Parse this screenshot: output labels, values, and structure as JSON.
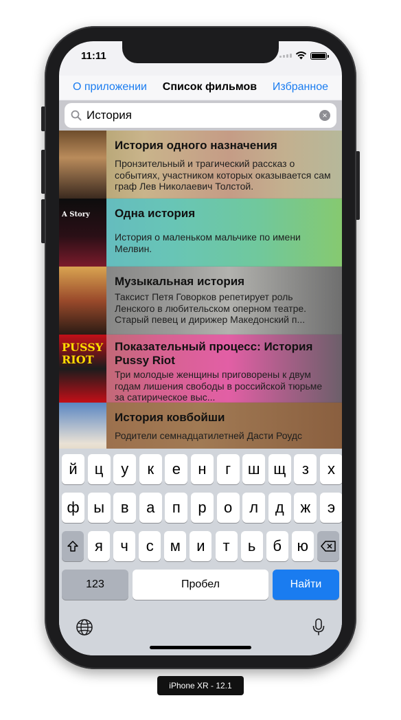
{
  "status_bar": {
    "time": "11:11"
  },
  "navbar": {
    "left": "О приложении",
    "title": "Список фильмов",
    "right": "Избранное"
  },
  "search": {
    "value": "История",
    "placeholder": ""
  },
  "movies": [
    {
      "title": "История одного назначения",
      "description": "Пронзительный и трагический рассказ о событиях, участником которых оказывается сам граф Лев Николаевич Толстой."
    },
    {
      "title": "Одна история",
      "description": "История о маленьком мальчике по имени Мелвин.",
      "poster_text": "A Story"
    },
    {
      "title": "Музыкальная история",
      "description": "Таксист Петя Говорков репетирует роль Ленского в любительском оперном театре. Старый певец и дирижер Македонский п..."
    },
    {
      "title": "Показательный процесс: История Pussy Riot",
      "description": "Три молодые женщины приговорены к двум годам лишения свободы в российской тюрьме за сатирическое выс...",
      "poster_text": "PUSSY RIOT"
    },
    {
      "title": "История ковбойши",
      "description": "Родители семнадцатилетней Дасти Роудс"
    }
  ],
  "keyboard": {
    "row1": [
      "й",
      "ц",
      "у",
      "к",
      "е",
      "н",
      "г",
      "ш",
      "щ",
      "з",
      "х"
    ],
    "row2": [
      "ф",
      "ы",
      "в",
      "а",
      "п",
      "р",
      "о",
      "л",
      "д",
      "ж",
      "э"
    ],
    "row3": [
      "я",
      "ч",
      "с",
      "м",
      "и",
      "т",
      "ь",
      "б",
      "ю"
    ],
    "numbers_key": "123",
    "space_key": "Пробел",
    "return_key": "Найти"
  },
  "device_label": "iPhone XR - 12.1",
  "colors": {
    "accent": "#1a7cf0"
  },
  "icons": [
    "search-icon",
    "clear-icon",
    "shift-icon",
    "backspace-icon",
    "globe-icon",
    "mic-icon",
    "wifi-icon",
    "battery-icon"
  ]
}
